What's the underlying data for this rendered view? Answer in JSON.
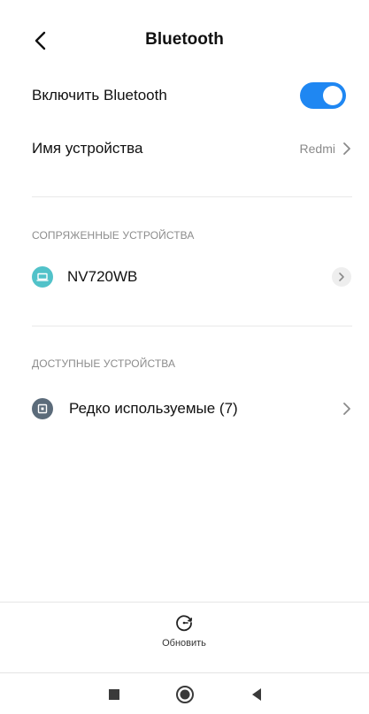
{
  "header": {
    "title": "Bluetooth"
  },
  "settings": {
    "bluetooth_toggle_label": "Включить Bluetooth",
    "bluetooth_enabled": true,
    "device_name_label": "Имя устройства",
    "device_name_value": "Redmi"
  },
  "paired": {
    "title": "СОПРЯЖЕННЫЕ УСТРОЙСТВА",
    "devices": [
      {
        "name": "NV720WB",
        "icon": "laptop-icon"
      }
    ]
  },
  "available": {
    "title": "ДОСТУПНЫЕ УСТРОЙСТВА",
    "devices": [
      {
        "name": "Редко используемые (7)",
        "icon": "device-group-icon"
      }
    ]
  },
  "actions": {
    "refresh_label": "Обновить"
  },
  "colors": {
    "accent": "#1f87f2",
    "paired_icon_bg": "#51c2c9",
    "available_icon_bg": "#5b6b7a"
  }
}
